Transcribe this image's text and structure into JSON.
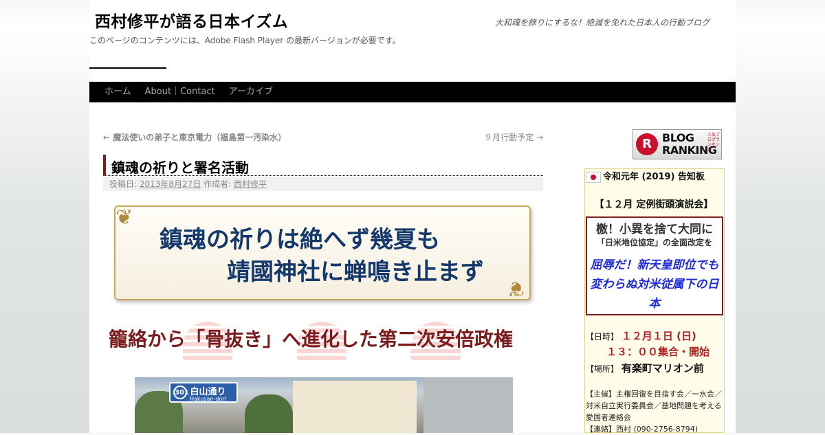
{
  "site": {
    "title": "西村修平が語る日本イズム",
    "description": "大和魂を飾りにするな！絶滅を免れた日本人の行動ブログ",
    "flash_note": "このページのコンテンツには、Adobe Flash Player の最新バージョンが必要です。"
  },
  "menu": [
    "ホーム",
    "About｜Contact",
    "アーカイブ"
  ],
  "post_nav": {
    "prev": "← 魔法使いの弟子と東京電力（福島第一汚染水）",
    "next": "９月行動予定 →"
  },
  "entry": {
    "title": "鎮魂の祈りと署名活動",
    "meta_posted_label": "投稿日:",
    "meta_date": "2013年8月27日",
    "meta_author_label": "作成者:",
    "meta_author": "西村修平",
    "banner_line1": "鎮魂の祈りは絶へず幾夏も",
    "banner_line2": "靖國神社に蝉鳴き止まず",
    "headline": "籠絡から「骨抜き」へ進化した第二次安倍政権",
    "photo_sign_num": "301",
    "photo_sign_text": "白山通り",
    "photo_sign_sub": "Hakusan-dori"
  },
  "sidebar": {
    "ranking_badge_text": "BLOG RANKING",
    "ranking_badge_small": "人気ブログランキング",
    "notice_title": "令和元年 (2019) 告知板",
    "notice_event": "【１２月 定例街頭演説会】",
    "box_line1": "檄！小異を捨て大同に",
    "box_line2": "「日米地位協定」の全面改定を",
    "box_line3": "屈辱だ！新天皇即位でも変わらぬ対米従属下の日本",
    "date_label": "【日時】",
    "date_value": "１２月１日 (日)",
    "time_value": "１３：００集合・開始",
    "place_label": "【場所】",
    "place_value": "有楽町マリオン前",
    "organizer": "【主催】主権回復を目指す会／一水会／対米自立実行委員会／基地問題を考える愛国者連絡会",
    "contact": "【連絡】西村 (090-2756-8794)"
  },
  "colors": {
    "title_accent": "#7b1e1e",
    "banner_text": "#15386b",
    "headline_text": "#7a1c1c",
    "notice_blue": "#1f2dd6",
    "notice_red": "#b32020"
  }
}
